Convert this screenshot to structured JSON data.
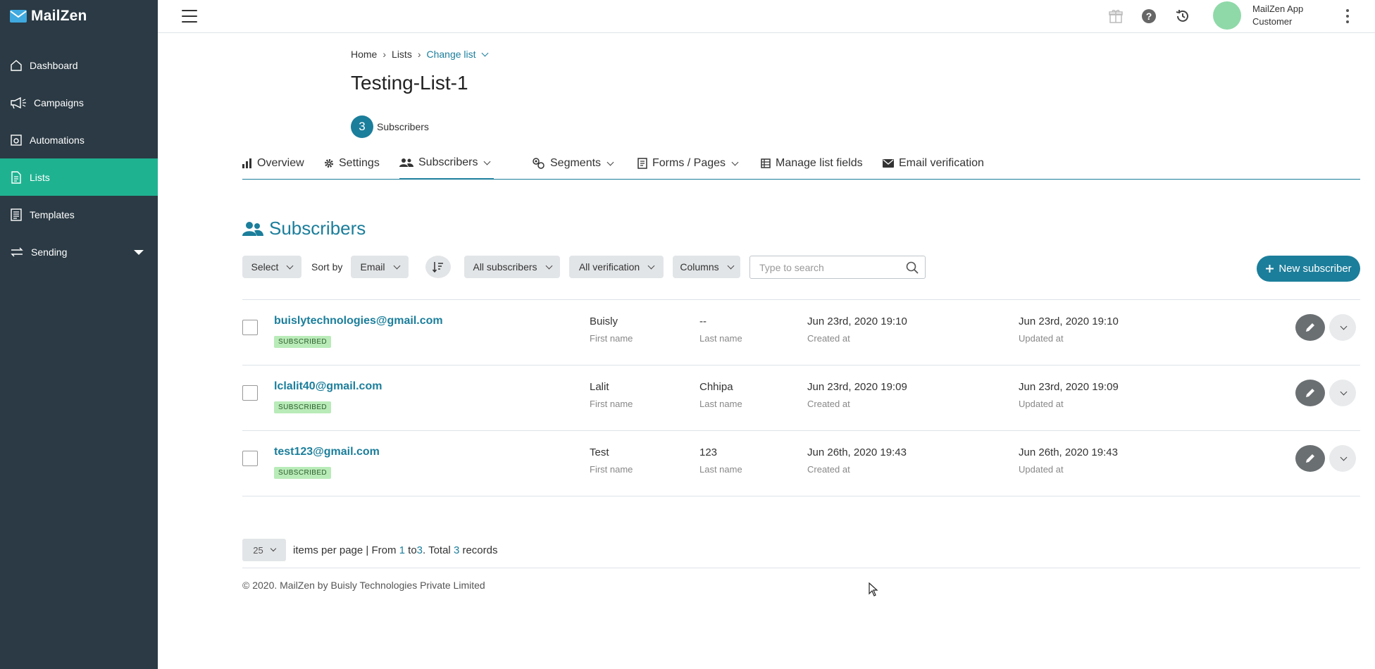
{
  "app": {
    "name": "MailZen"
  },
  "sidebar": {
    "items": [
      {
        "label": "Dashboard",
        "icon": "home-icon"
      },
      {
        "label": "Campaigns",
        "icon": "megaphone-icon"
      },
      {
        "label": "Automations",
        "icon": "automation-icon"
      },
      {
        "label": "Lists",
        "icon": "list-doc-icon",
        "active": true
      },
      {
        "label": "Templates",
        "icon": "template-icon"
      },
      {
        "label": "Sending",
        "icon": "transfer-icon"
      }
    ]
  },
  "header": {
    "user_name": "MailZen App",
    "user_role": "Customer",
    "icons": [
      "gift-icon",
      "help-icon",
      "history-icon",
      "more-vertical-icon"
    ]
  },
  "breadcrumb": {
    "home": "Home",
    "lists": "Lists",
    "change": "Change list"
  },
  "page": {
    "title": "Testing-List-1",
    "subscriber_count": "3",
    "subscriber_label": "Subscribers"
  },
  "tabs": [
    {
      "label": "Overview",
      "icon": "bar-chart-icon"
    },
    {
      "label": "Settings",
      "icon": "gear-icon"
    },
    {
      "label": "Subscribers",
      "icon": "users-icon",
      "active": true
    },
    {
      "label": "Segments",
      "icon": "segments-icon"
    },
    {
      "label": "Forms / Pages",
      "icon": "forms-icon"
    },
    {
      "label": "Manage list fields",
      "icon": "fields-icon"
    },
    {
      "label": "Email verification",
      "icon": "envelope-icon"
    }
  ],
  "section": {
    "title": "Subscribers"
  },
  "toolbar": {
    "select": "Select",
    "sort_by": "Sort by",
    "sort_field": "Email",
    "filter_subscribers": "All subscribers",
    "filter_verification": "All verification",
    "columns": "Columns",
    "search_placeholder": "Type to search",
    "new_subscriber": "New subscriber"
  },
  "subscribers": [
    {
      "email": "buislytechnologies@gmail.com",
      "status": "SUBSCRIBED",
      "first_name": "Buisly",
      "last_name": "--",
      "created": "Jun 23rd, 2020 19:10",
      "updated": "Jun 23rd, 2020 19:10"
    },
    {
      "email": "lclalit40@gmail.com",
      "status": "SUBSCRIBED",
      "first_name": "Lalit",
      "last_name": "Chhipa",
      "created": "Jun 23rd, 2020 19:09",
      "updated": "Jun 23rd, 2020 19:09"
    },
    {
      "email": "test123@gmail.com",
      "status": "SUBSCRIBED",
      "first_name": "Test",
      "last_name": "123",
      "created": "Jun 26th, 2020 19:43",
      "updated": "Jun 26th, 2020 19:43"
    }
  ],
  "field_labels": {
    "first_name": "First name",
    "last_name": "Last name",
    "created": "Created at",
    "updated": "Updated at"
  },
  "pager": {
    "per_page": "25",
    "items_per_page": "items per page",
    "separator": "| From",
    "from": "1",
    "to_word": "to",
    "to": "3",
    "total_word": ". Total",
    "total": "3",
    "records": "records"
  },
  "footer": {
    "text": "© 2020. MailZen by Buisly Technologies Private Limited"
  },
  "colors": {
    "sidebar_bg": "#2b3a44",
    "active_green": "#1fb291",
    "accent": "#1b7e9b",
    "badge_bg": "#b8ebb8"
  }
}
